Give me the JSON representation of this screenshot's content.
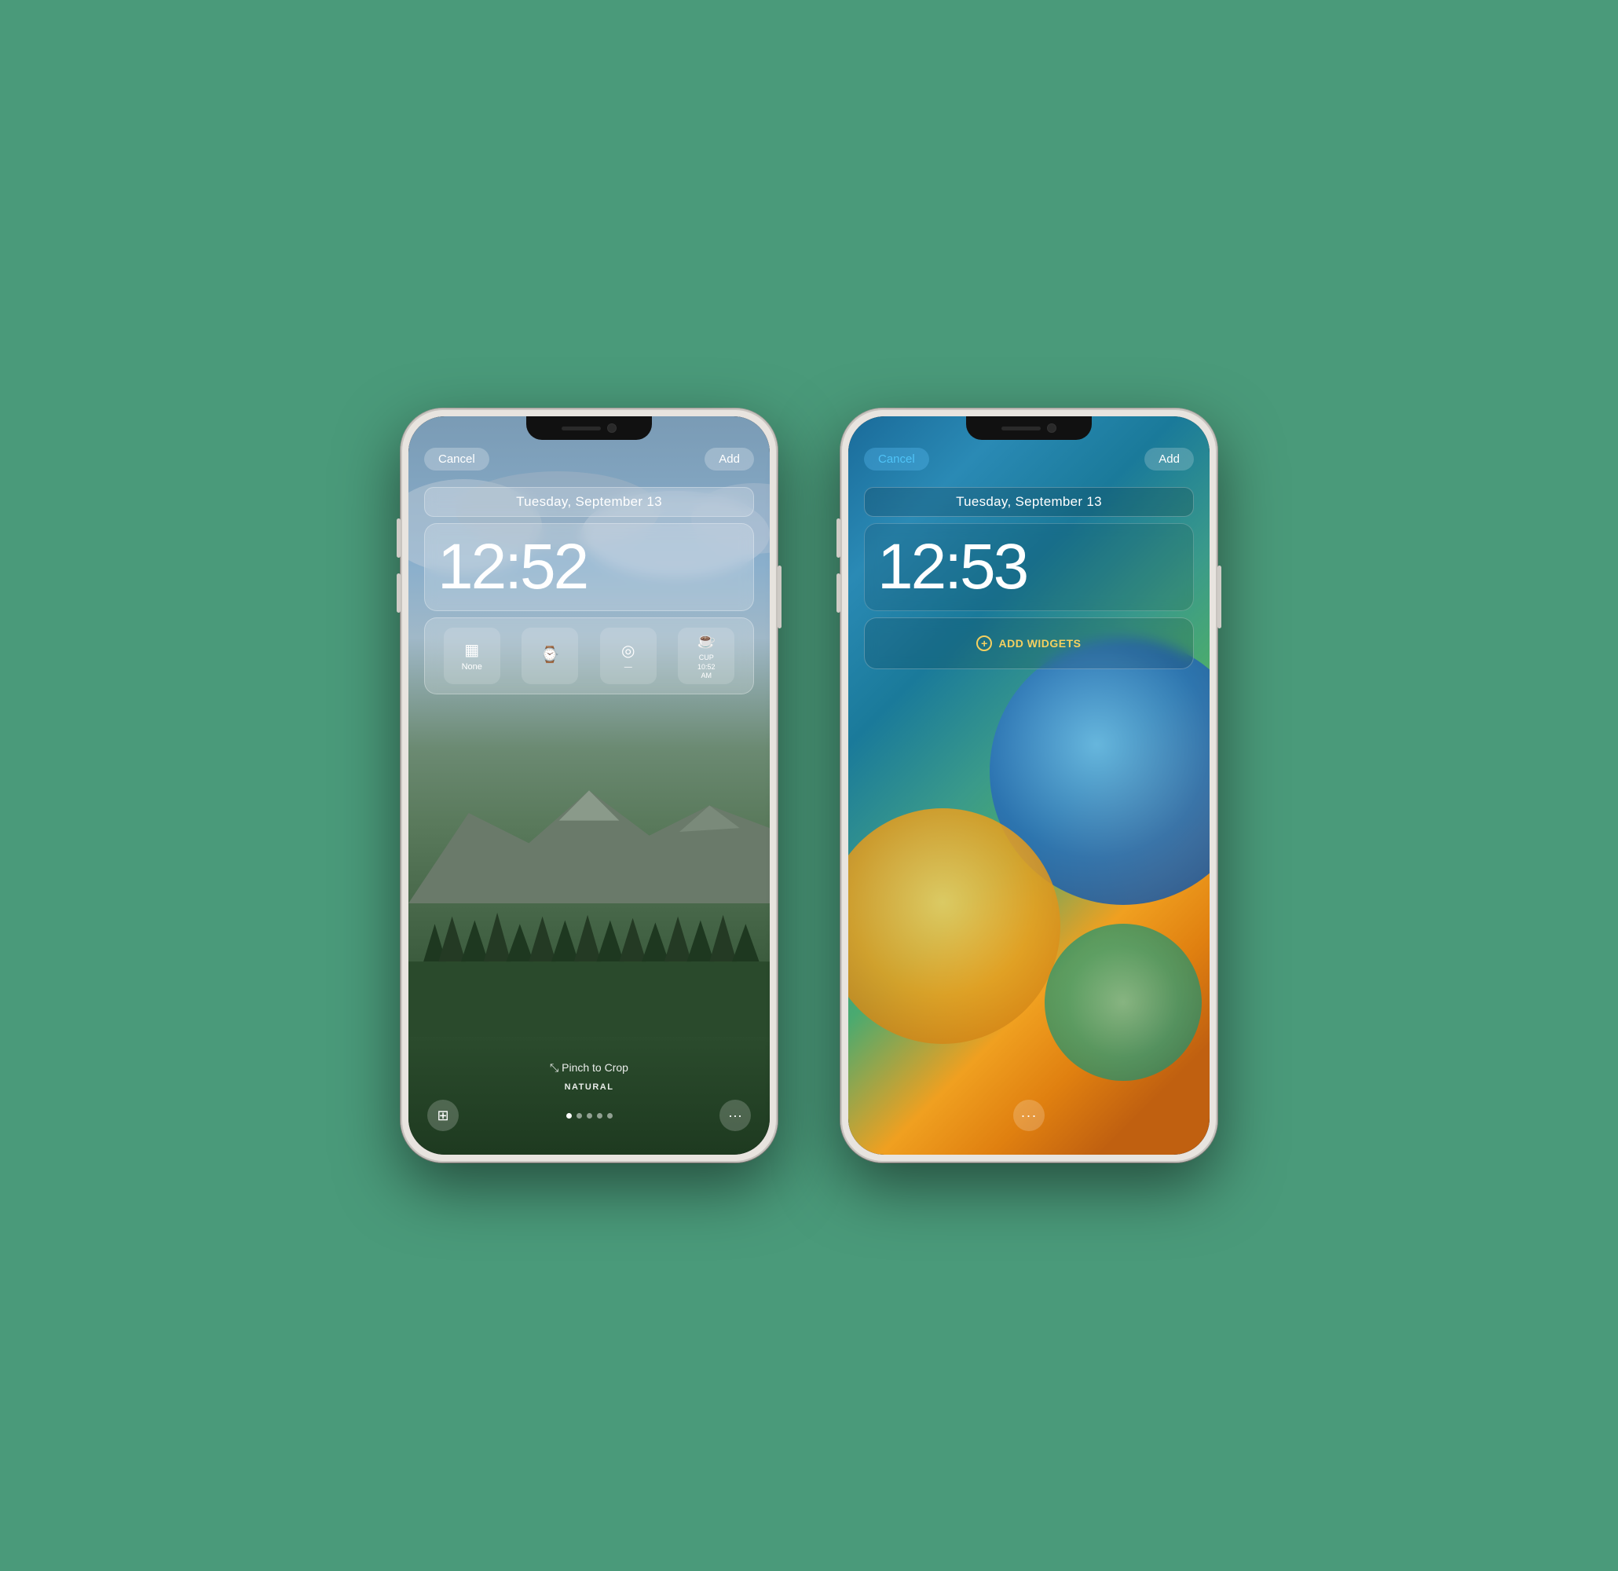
{
  "background_color": "#4a9a7a",
  "phone1": {
    "cancel_label": "Cancel",
    "add_label": "Add",
    "date": "Tuesday, September 13",
    "time": "12:52",
    "widgets": [
      {
        "icon": "▦",
        "label": "None"
      },
      {
        "icon": "⌚",
        "label": ""
      },
      {
        "icon": "◎",
        "label": "—"
      },
      {
        "icon": "☕",
        "label": "CUP\n10:52\nAM"
      }
    ],
    "pinch_label": "⤡ Pinch to Crop",
    "filter_label": "NATURAL",
    "dots": [
      true,
      false,
      false,
      false,
      false
    ],
    "bottom_left_icon": "⊞",
    "bottom_right_icon": "···"
  },
  "phone2": {
    "cancel_label": "Cancel",
    "add_label": "Add",
    "date": "Tuesday, September 13",
    "time": "12:53",
    "add_widgets_label": "ADD WIDGETS",
    "bottom_icon": "···"
  }
}
